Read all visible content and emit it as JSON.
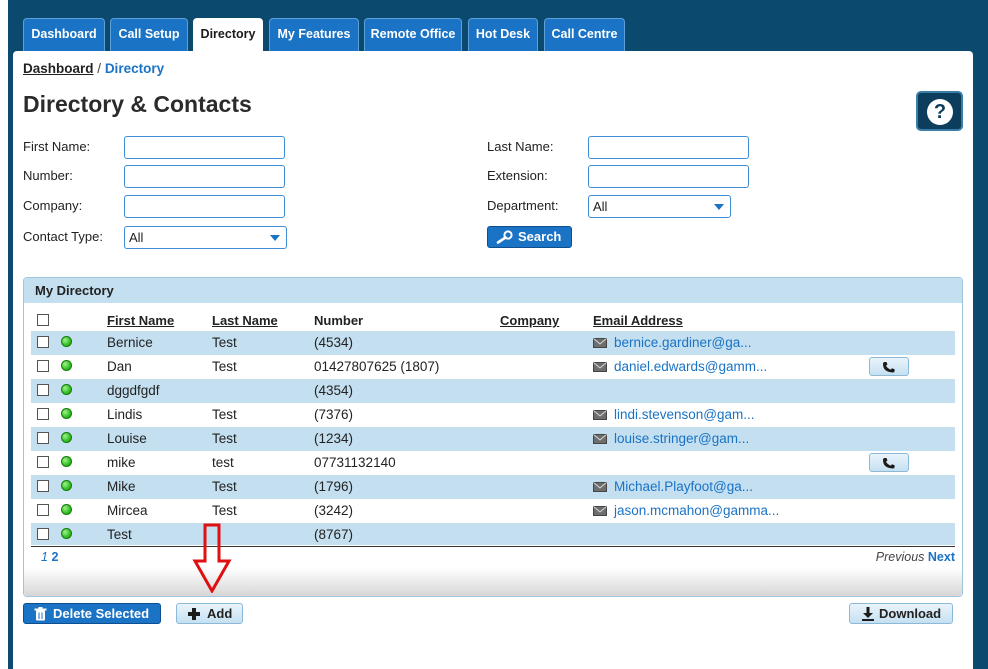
{
  "tabs": [
    {
      "label": "Dashboard",
      "active": false
    },
    {
      "label": "Call Setup",
      "active": false
    },
    {
      "label": "Directory",
      "active": true
    },
    {
      "label": "My Features",
      "active": false
    },
    {
      "label": "Remote Office",
      "active": false
    },
    {
      "label": "Hot Desk",
      "active": false
    },
    {
      "label": "Call Centre",
      "active": false
    }
  ],
  "breadcrumb": {
    "home": "Dashboard",
    "separator": "/",
    "current": "Directory"
  },
  "page_title": "Directory & Contacts",
  "help": {
    "label": "?"
  },
  "form": {
    "first_name_label": "First Name:",
    "first_name_value": "",
    "number_label": "Number:",
    "number_value": "",
    "company_label": "Company:",
    "company_value": "",
    "contact_type_label": "Contact Type:",
    "contact_type_value": "All",
    "last_name_label": "Last Name:",
    "last_name_value": "",
    "extension_label": "Extension:",
    "extension_value": "",
    "department_label": "Department:",
    "department_value": "All",
    "search_label": "Search"
  },
  "directory": {
    "title": "My Directory",
    "columns": {
      "first_name": "First Name",
      "last_name": "Last Name",
      "number": "Number",
      "company": "Company",
      "email": "Email Address"
    },
    "rows": [
      {
        "first": "Bernice",
        "last": "Test",
        "number": "(4534)",
        "company": "",
        "email": "bernice.gardiner@ga...",
        "call": false
      },
      {
        "first": "Dan",
        "last": "Test",
        "number": "01427807625 (1807)",
        "company": "",
        "email": "daniel.edwards@gamm...",
        "call": true
      },
      {
        "first": "dggdfgdf",
        "last": "",
        "number": "(4354)",
        "company": "",
        "email": "",
        "call": false
      },
      {
        "first": "Lindis",
        "last": "Test",
        "number": "(7376)",
        "company": "",
        "email": "lindi.stevenson@gam...",
        "call": false
      },
      {
        "first": "Louise",
        "last": "Test",
        "number": "(1234)",
        "company": "",
        "email": "louise.stringer@gam...",
        "call": false
      },
      {
        "first": "mike",
        "last": "test",
        "number": "07731132140",
        "company": "",
        "email": "",
        "call": true
      },
      {
        "first": "Mike",
        "last": "Test",
        "number": "(1796)",
        "company": "",
        "email": "Michael.Playfoot@ga...",
        "call": false
      },
      {
        "first": "Mircea",
        "last": "Test",
        "number": "(3242)",
        "company": "",
        "email": "jason.mcmahon@gamma...",
        "call": false
      },
      {
        "first": "Test",
        "last": "",
        "number": "(8767)",
        "company": "",
        "email": "",
        "call": false
      }
    ],
    "pager": {
      "page_current": "1",
      "page_other": "2",
      "previous": "Previous",
      "next": "Next"
    }
  },
  "actions": {
    "delete_label": "Delete Selected",
    "add_label": "Add",
    "download_label": "Download"
  },
  "colors": {
    "brand_blue": "#1a73c4",
    "frame_dark": "#0b4a6e",
    "row_alt": "#c3dff0",
    "status_online": "#22b514",
    "annotation_arrow": "#e01010"
  }
}
